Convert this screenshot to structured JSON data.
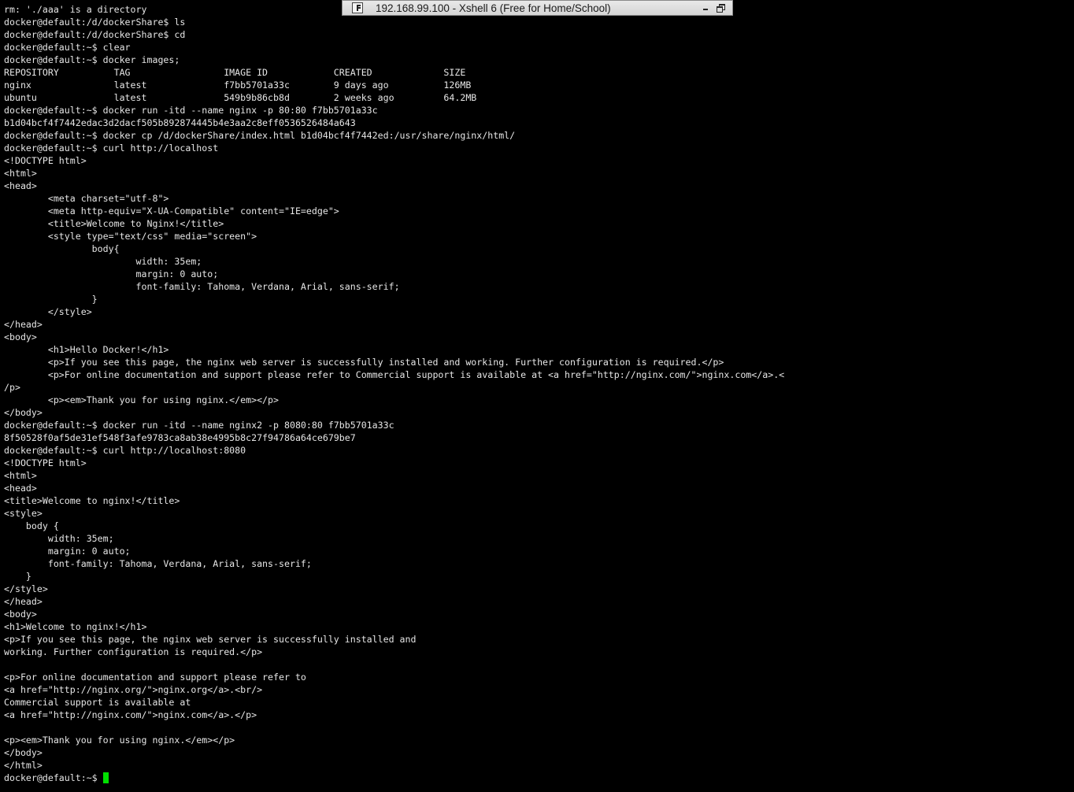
{
  "window": {
    "title": "192.168.99.100 - Xshell 6 (Free for Home/School)",
    "icon": "xshell-app-icon"
  },
  "terminal": {
    "lines": [
      "rm: './aaa' is a directory",
      "docker@default:/d/dockerShare$ ls",
      "docker@default:/d/dockerShare$ cd",
      "docker@default:~$ clear",
      "docker@default:~$ docker images;",
      "REPOSITORY          TAG                 IMAGE ID            CREATED             SIZE",
      "nginx               latest              f7bb5701a33c        9 days ago          126MB",
      "ubuntu              latest              549b9b86cb8d        2 weeks ago         64.2MB",
      "docker@default:~$ docker run -itd --name nginx -p 80:80 f7bb5701a33c",
      "b1d04bcf4f7442edac3d2dacf505b892874445b4e3aa2c8eff0536526484a643",
      "docker@default:~$ docker cp /d/dockerShare/index.html b1d04bcf4f7442ed:/usr/share/nginx/html/",
      "docker@default:~$ curl http://localhost",
      "<!DOCTYPE html>",
      "<html>",
      "<head>",
      "        <meta charset=\"utf-8\">",
      "        <meta http-equiv=\"X-UA-Compatible\" content=\"IE=edge\">",
      "        <title>Welcome to Nginx!</title>",
      "        <style type=\"text/css\" media=\"screen\">",
      "                body{",
      "                        width: 35em;",
      "                        margin: 0 auto;",
      "                        font-family: Tahoma, Verdana, Arial, sans-serif;",
      "                }",
      "        </style>",
      "</head>",
      "<body>",
      "        <h1>Hello Docker!</h1>",
      "        <p>If you see this page, the nginx web server is successfully installed and working. Further configuration is required.</p>",
      "        <p>For online documentation and support please refer to Commercial support is available at <a href=\"http://nginx.com/\">nginx.com</a>.<",
      "/p>",
      "        <p><em>Thank you for using nginx.</em></p>",
      "</body>",
      "docker@default:~$ docker run -itd --name nginx2 -p 8080:80 f7bb5701a33c",
      "8f50528f0af5de31ef548f3afe9783ca8ab38e4995b8c27f94786a64ce679be7",
      "docker@default:~$ curl http://localhost:8080",
      "<!DOCTYPE html>",
      "<html>",
      "<head>",
      "<title>Welcome to nginx!</title>",
      "<style>",
      "    body {",
      "        width: 35em;",
      "        margin: 0 auto;",
      "        font-family: Tahoma, Verdana, Arial, sans-serif;",
      "    }",
      "</style>",
      "</head>",
      "<body>",
      "<h1>Welcome to nginx!</h1>",
      "<p>If you see this page, the nginx web server is successfully installed and",
      "working. Further configuration is required.</p>",
      "",
      "<p>For online documentation and support please refer to",
      "<a href=\"http://nginx.org/\">nginx.org</a>.<br/>",
      "Commercial support is available at",
      "<a href=\"http://nginx.com/\">nginx.com</a>.</p>",
      "",
      "<p><em>Thank you for using nginx.</em></p>",
      "</body>",
      "</html>"
    ],
    "prompt": "docker@default:~$ ",
    "cursor_color": "#00e000",
    "text_color": "#e6e6e6",
    "background": "#000000"
  }
}
